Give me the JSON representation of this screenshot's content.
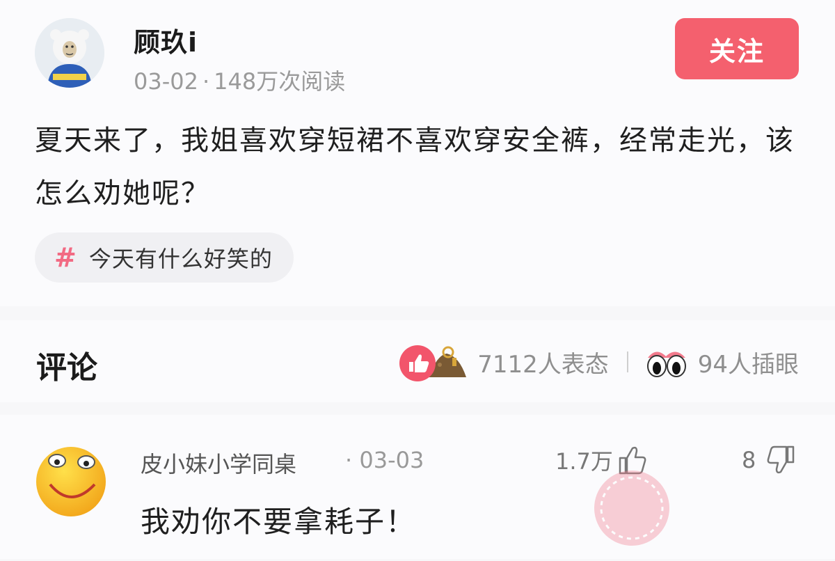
{
  "post": {
    "author": "顾玖i",
    "date": "03-02",
    "separator": "·",
    "views": "148万次阅读",
    "follow_label": "关注",
    "text": "夏天来了，我姐喜欢穿短裙不喜欢穿安全裤，经常走光，该怎么劝她呢？",
    "topic": {
      "icon": "hash-icon",
      "label": "今天有什么好笑的"
    }
  },
  "comments_section": {
    "title": "评论",
    "reactions": [
      {
        "icons": [
          "thumb-up-icon",
          "shovel-dirt-icon"
        ],
        "label": "7112人表态"
      },
      {
        "icon": "eyes-icon",
        "label": "94人插眼"
      }
    ]
  },
  "comments": [
    {
      "user": "皮小妹小学同桌",
      "date": "· 03-03",
      "likes": "1.7万",
      "dislikes": "8",
      "text": "我劝你不要拿耗子！"
    }
  ],
  "colors": {
    "accent": "#f4606e",
    "topic_hash": "#f26a83",
    "muted_text": "#9a9a9a"
  }
}
